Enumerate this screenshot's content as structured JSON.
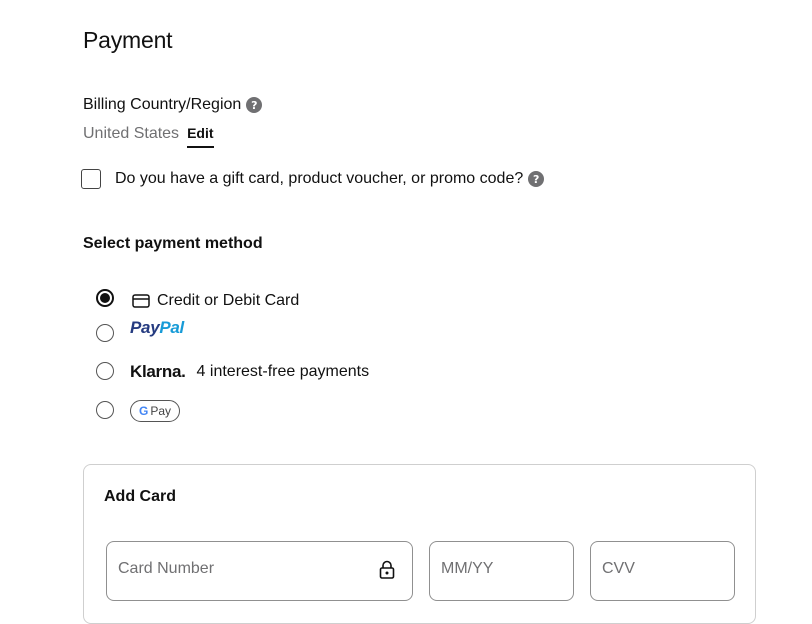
{
  "page": {
    "title": "Payment"
  },
  "billing": {
    "label": "Billing Country/Region",
    "country": "United States",
    "edit_label": "Edit"
  },
  "promo": {
    "label": "Do you have a gift card, product voucher, or promo code?",
    "checked": false
  },
  "payment_methods": {
    "title": "Select payment method",
    "options": [
      {
        "id": "card",
        "label": "Credit or Debit Card",
        "icon": "credit-card-icon",
        "selected": true
      },
      {
        "id": "paypal",
        "label_pay": "Pay",
        "label_pal": "Pal",
        "selected": false
      },
      {
        "id": "klarna",
        "brand": "Klarna.",
        "label": "4 interest-free payments",
        "selected": false
      },
      {
        "id": "gpay",
        "g": "G",
        "label": "Pay",
        "selected": false
      }
    ]
  },
  "add_card": {
    "title": "Add Card",
    "card_number_placeholder": "Card Number",
    "expiry_placeholder": "MM/YY",
    "cvv_placeholder": "CVV"
  },
  "colors": {
    "text": "#111111",
    "muted": "#707072",
    "paypal_dark": "#253b80",
    "paypal_light": "#179bd7",
    "border": "#cfcfcf"
  }
}
